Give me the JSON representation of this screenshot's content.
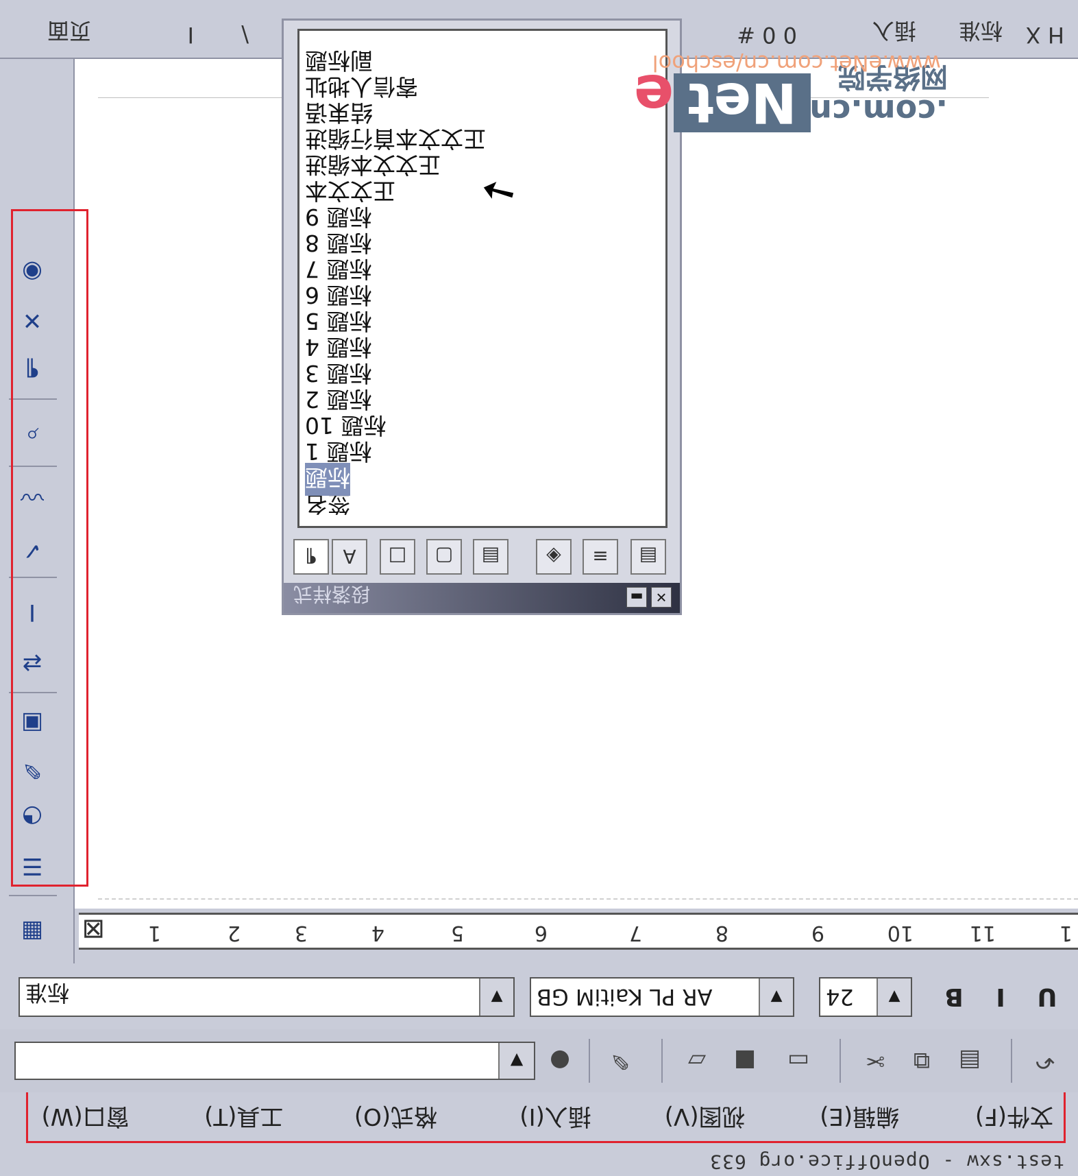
{
  "title_bar": {
    "text": "test.sxw - OpenOffice.org 633"
  },
  "menu_bar": {
    "items": [
      "文件(F)",
      "编辑(E)",
      "视图(V)",
      "插入(I)",
      "格式(O)",
      "工具(T)",
      "窗口(W)"
    ]
  },
  "function_bar": {
    "url_value": ""
  },
  "format_bar": {
    "paragraph_style": "标准",
    "font_name": "AR PL KaitiM GB",
    "font_size": "24",
    "bold_label": "B",
    "italic_label": "I",
    "underline_label": "U"
  },
  "ruler": {
    "labels": [
      "1",
      "2",
      "3",
      "4",
      "5",
      "6",
      "7",
      "8",
      "9",
      "10",
      "11",
      "1"
    ]
  },
  "object_bar": {
    "segments": [
      "页面",
      "I",
      "\\",
      "I",
      "0 0 #",
      "插入",
      "标准",
      "H X"
    ]
  },
  "stylist": {
    "title": "段落样式",
    "styles": [
      "签名",
      "标题",
      "标题 1",
      "标题 10",
      "标题 2",
      "标题 3",
      "标题 4",
      "标题 5",
      "标题 6",
      "标题 7",
      "标题 8",
      "标题 9",
      "正文文本",
      "正文文本缩进",
      "正文文本首行缩进",
      "结束语",
      "寄信人地址",
      "副标题"
    ],
    "selected_index": 1
  },
  "watermark": {
    "url": "www.eNet.com.cn/eschool",
    "logo_e": "e",
    "logo_net": "Net",
    "logo_domain": ".com.cn",
    "logo_cn": "网络学院"
  },
  "colors": {
    "highlight": "#e0222e",
    "chrome": "#c9ccd9",
    "selection": "#7f8fb8"
  }
}
